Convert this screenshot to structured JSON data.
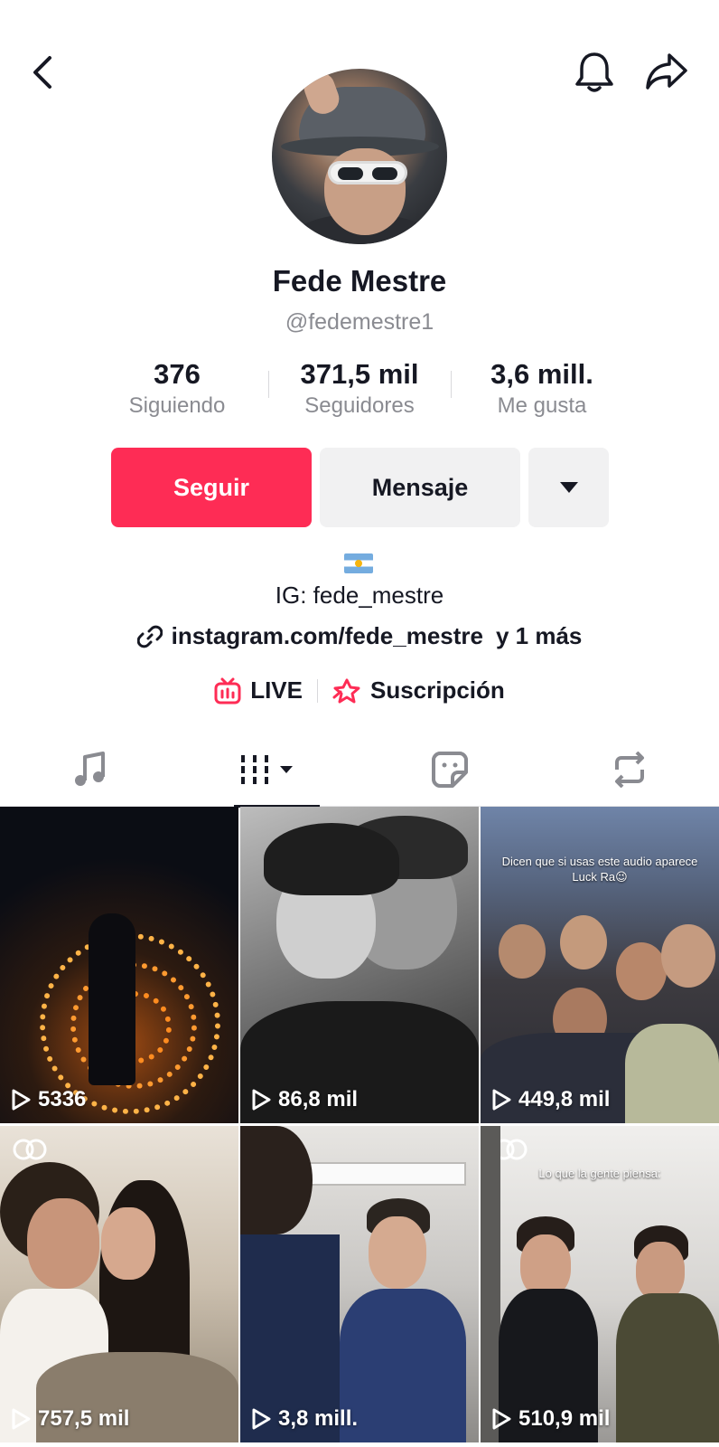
{
  "profile": {
    "name": "Fede Mestre",
    "handle": "@fedemestre1",
    "bio": "IG: fede_mestre",
    "link_text": "instagram.com/fede_mestre",
    "link_suffix": "y 1 más"
  },
  "stats": [
    {
      "value": "376",
      "label": "Siguiendo"
    },
    {
      "value": "371,5 mil",
      "label": "Seguidores"
    },
    {
      "value": "3,6 mill.",
      "label": "Me gusta"
    }
  ],
  "actions": {
    "follow_label": "Seguir",
    "message_label": "Mensaje"
  },
  "badges": {
    "live_label": "LIVE",
    "subscription_label": "Suscripción"
  },
  "colors": {
    "accent": "#fe2c55",
    "text": "#161823",
    "muted": "#8a8b91"
  },
  "icons": [
    "back-icon",
    "bell-icon",
    "share-icon",
    "dropdown-arrow-icon",
    "flag-argentina-icon",
    "link-icon",
    "live-icon",
    "subscription-icon",
    "music-note-icon",
    "videos-grid-icon",
    "sticker-icon",
    "repost-icon",
    "play-icon",
    "collab-icon"
  ],
  "videos": [
    {
      "views": "5336"
    },
    {
      "views": "86,8 mil"
    },
    {
      "views": "449,8 mil",
      "caption": "Dicen que si usas este audio aparece Luck Ra😉"
    },
    {
      "views": "757,5 mil"
    },
    {
      "views": "3,8 mill."
    },
    {
      "views": "510,9 mil",
      "caption": "Lo que la gente piensa:"
    }
  ]
}
